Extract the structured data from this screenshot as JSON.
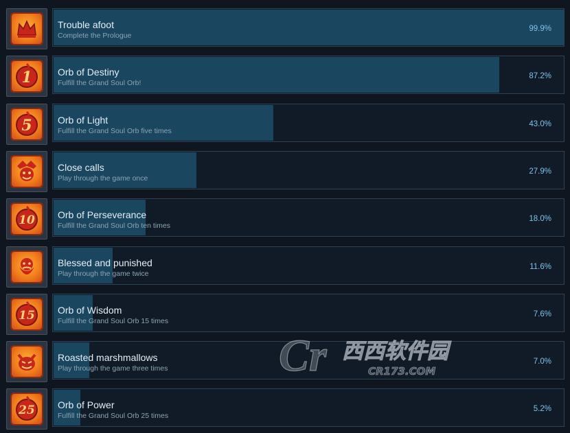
{
  "achievements": [
    {
      "title": "Trouble afoot",
      "description": "Complete the Prologue",
      "percent": "99.9%",
      "percent_value": 99.9,
      "icon": "crown-icon",
      "glyph": ""
    },
    {
      "title": "Orb of Destiny",
      "description": "Fulfill the Grand Soul Orb!",
      "percent": "87.2%",
      "percent_value": 87.2,
      "icon": "orb-1-icon",
      "glyph": "1"
    },
    {
      "title": "Orb of Light",
      "description": "Fulfill the Grand Soul Orb five times",
      "percent": "43.0%",
      "percent_value": 43.0,
      "icon": "orb-5-icon",
      "glyph": "5"
    },
    {
      "title": "Close calls",
      "description": "Play through the game once",
      "percent": "27.9%",
      "percent_value": 27.9,
      "icon": "jester-face-icon",
      "glyph": ""
    },
    {
      "title": "Orb of Perseverance",
      "description": "Fulfill the Grand Soul Orb ten times",
      "percent": "18.0%",
      "percent_value": 18.0,
      "icon": "orb-10-icon",
      "glyph": "10"
    },
    {
      "title": "Blessed and punished",
      "description": "Play through the game twice",
      "percent": "11.6%",
      "percent_value": 11.6,
      "icon": "bearded-face-icon",
      "glyph": ""
    },
    {
      "title": "Orb of Wisdom",
      "description": "Fulfill the Grand Soul Orb 15 times",
      "percent": "7.6%",
      "percent_value": 7.6,
      "icon": "orb-15-icon",
      "glyph": "15"
    },
    {
      "title": "Roasted marshmallows",
      "description": "Play through the game three times",
      "percent": "7.0%",
      "percent_value": 7.0,
      "icon": "devil-face-icon",
      "glyph": ""
    },
    {
      "title": "Orb of Power",
      "description": "Fulfill the Grand Soul Orb 25 times",
      "percent": "5.2%",
      "percent_value": 5.2,
      "icon": "orb-25-icon",
      "glyph": "25"
    }
  ],
  "watermark": {
    "main": "西西软件园",
    "sub": "CR173.COM",
    "logo": "Cr"
  },
  "colors": {
    "bar_fill": "#1b4660",
    "bar_bg": "#101b27",
    "percent": "#7ec3ee",
    "icon_orange": "#f07a1a"
  }
}
